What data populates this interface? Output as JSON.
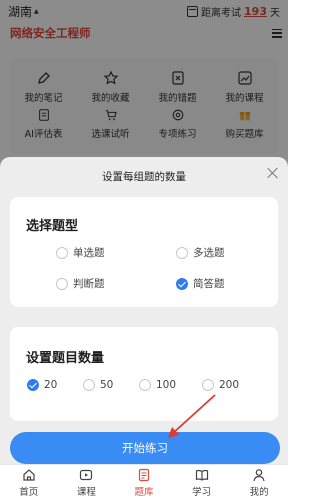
{
  "header": {
    "city": "湖南",
    "exam_prefix": "距离考试",
    "days": "193",
    "days_suffix": "天",
    "subject": "网络安全工程师"
  },
  "grid": [
    {
      "label": "我的笔记",
      "icon": "pencil-icon"
    },
    {
      "label": "我的收藏",
      "icon": "star-icon"
    },
    {
      "label": "我的错题",
      "icon": "wrong-book-icon"
    },
    {
      "label": "我的课程",
      "icon": "chart-icon"
    },
    {
      "label": "AI评估表",
      "icon": "ai-report-icon"
    },
    {
      "label": "选课试听",
      "icon": "cart-icon"
    },
    {
      "label": "专项练习",
      "icon": "target-icon"
    },
    {
      "label": "购买题库",
      "icon": "gift-icon"
    }
  ],
  "sheet": {
    "title": "设置每组题的数量",
    "type_section": {
      "title": "选择题型",
      "options": [
        {
          "label": "单选题",
          "checked": false
        },
        {
          "label": "多选题",
          "checked": false
        },
        {
          "label": "判断题",
          "checked": false
        },
        {
          "label": "简答题",
          "checked": true
        }
      ]
    },
    "count_section": {
      "title": "设置题目数量",
      "options": [
        {
          "label": "20",
          "checked": true
        },
        {
          "label": "50",
          "checked": false
        },
        {
          "label": "100",
          "checked": false
        },
        {
          "label": "200",
          "checked": false
        }
      ]
    },
    "start_label": "开始练习"
  },
  "tabs": [
    {
      "label": "首页",
      "icon": "home-icon",
      "active": false
    },
    {
      "label": "课程",
      "icon": "play-icon",
      "active": false
    },
    {
      "label": "题库",
      "icon": "question-bank-icon",
      "active": true
    },
    {
      "label": "学习",
      "icon": "book-icon",
      "active": false
    },
    {
      "label": "我的",
      "icon": "user-icon",
      "active": false
    }
  ],
  "colors": {
    "accent": "#3a8cf5",
    "brand_red": "#e0483a",
    "annotation_arrow": "#e03a2e"
  }
}
